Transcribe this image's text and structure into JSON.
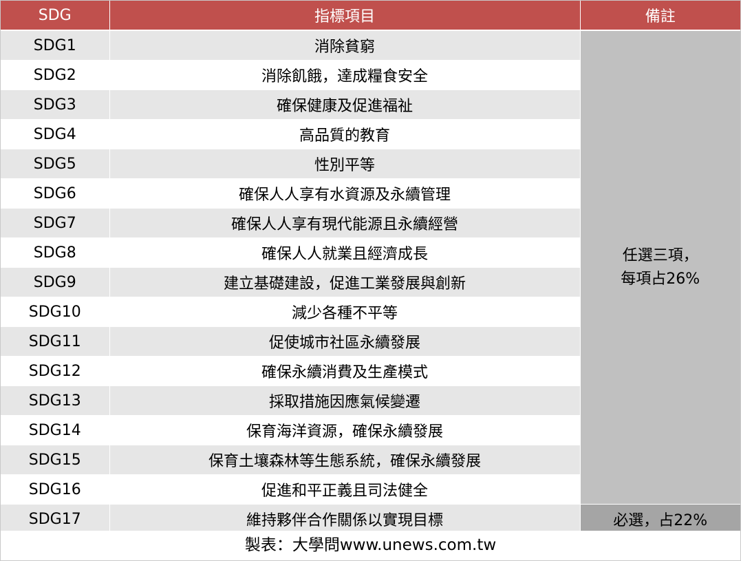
{
  "table": {
    "headers": [
      "SDG",
      "指標項目",
      "備註"
    ],
    "rows": [
      {
        "code": "SDG1",
        "item": "消除貧窮"
      },
      {
        "code": "SDG2",
        "item": "消除飢餓，達成糧食安全"
      },
      {
        "code": "SDG3",
        "item": "確保健康及促進福祉"
      },
      {
        "code": "SDG4",
        "item": "高品質的教育"
      },
      {
        "code": "SDG5",
        "item": "性別平等"
      },
      {
        "code": "SDG6",
        "item": "確保人人享有水資源及永續管理"
      },
      {
        "code": "SDG7",
        "item": "確保人人享有現代能源且永續經營"
      },
      {
        "code": "SDG8",
        "item": "確保人人就業且經濟成長"
      },
      {
        "code": "SDG9",
        "item": "建立基礎建設，促進工業發展與創新"
      },
      {
        "code": "SDG10",
        "item": "減少各種不平等"
      },
      {
        "code": "SDG11",
        "item": "促使城市社區永續發展"
      },
      {
        "code": "SDG12",
        "item": "確保永續消費及生產模式"
      },
      {
        "code": "SDG13",
        "item": "採取措施因應氣候變遷"
      },
      {
        "code": "SDG14",
        "item": "保育海洋資源，確保永續發展"
      },
      {
        "code": "SDG15",
        "item": "保育土壤森林等生態系統，確保永續發展"
      },
      {
        "code": "SDG16",
        "item": "促進和平正義且司法健全"
      },
      {
        "code": "SDG17",
        "item": "維持夥伴合作關係以實現目標"
      }
    ],
    "notes": {
      "elective_line1": "任選三項，",
      "elective_line2": "每項占26%",
      "required": "必選，占22%"
    }
  },
  "caption": "製表：大學問www.unews.com.tw",
  "colors": {
    "header_bg": "#c0504d",
    "header_text": "#ffffff",
    "row_shade": "#e6e6e6",
    "note_elective_bg": "#c0c0c0",
    "note_required_bg": "#a5a5a5"
  }
}
